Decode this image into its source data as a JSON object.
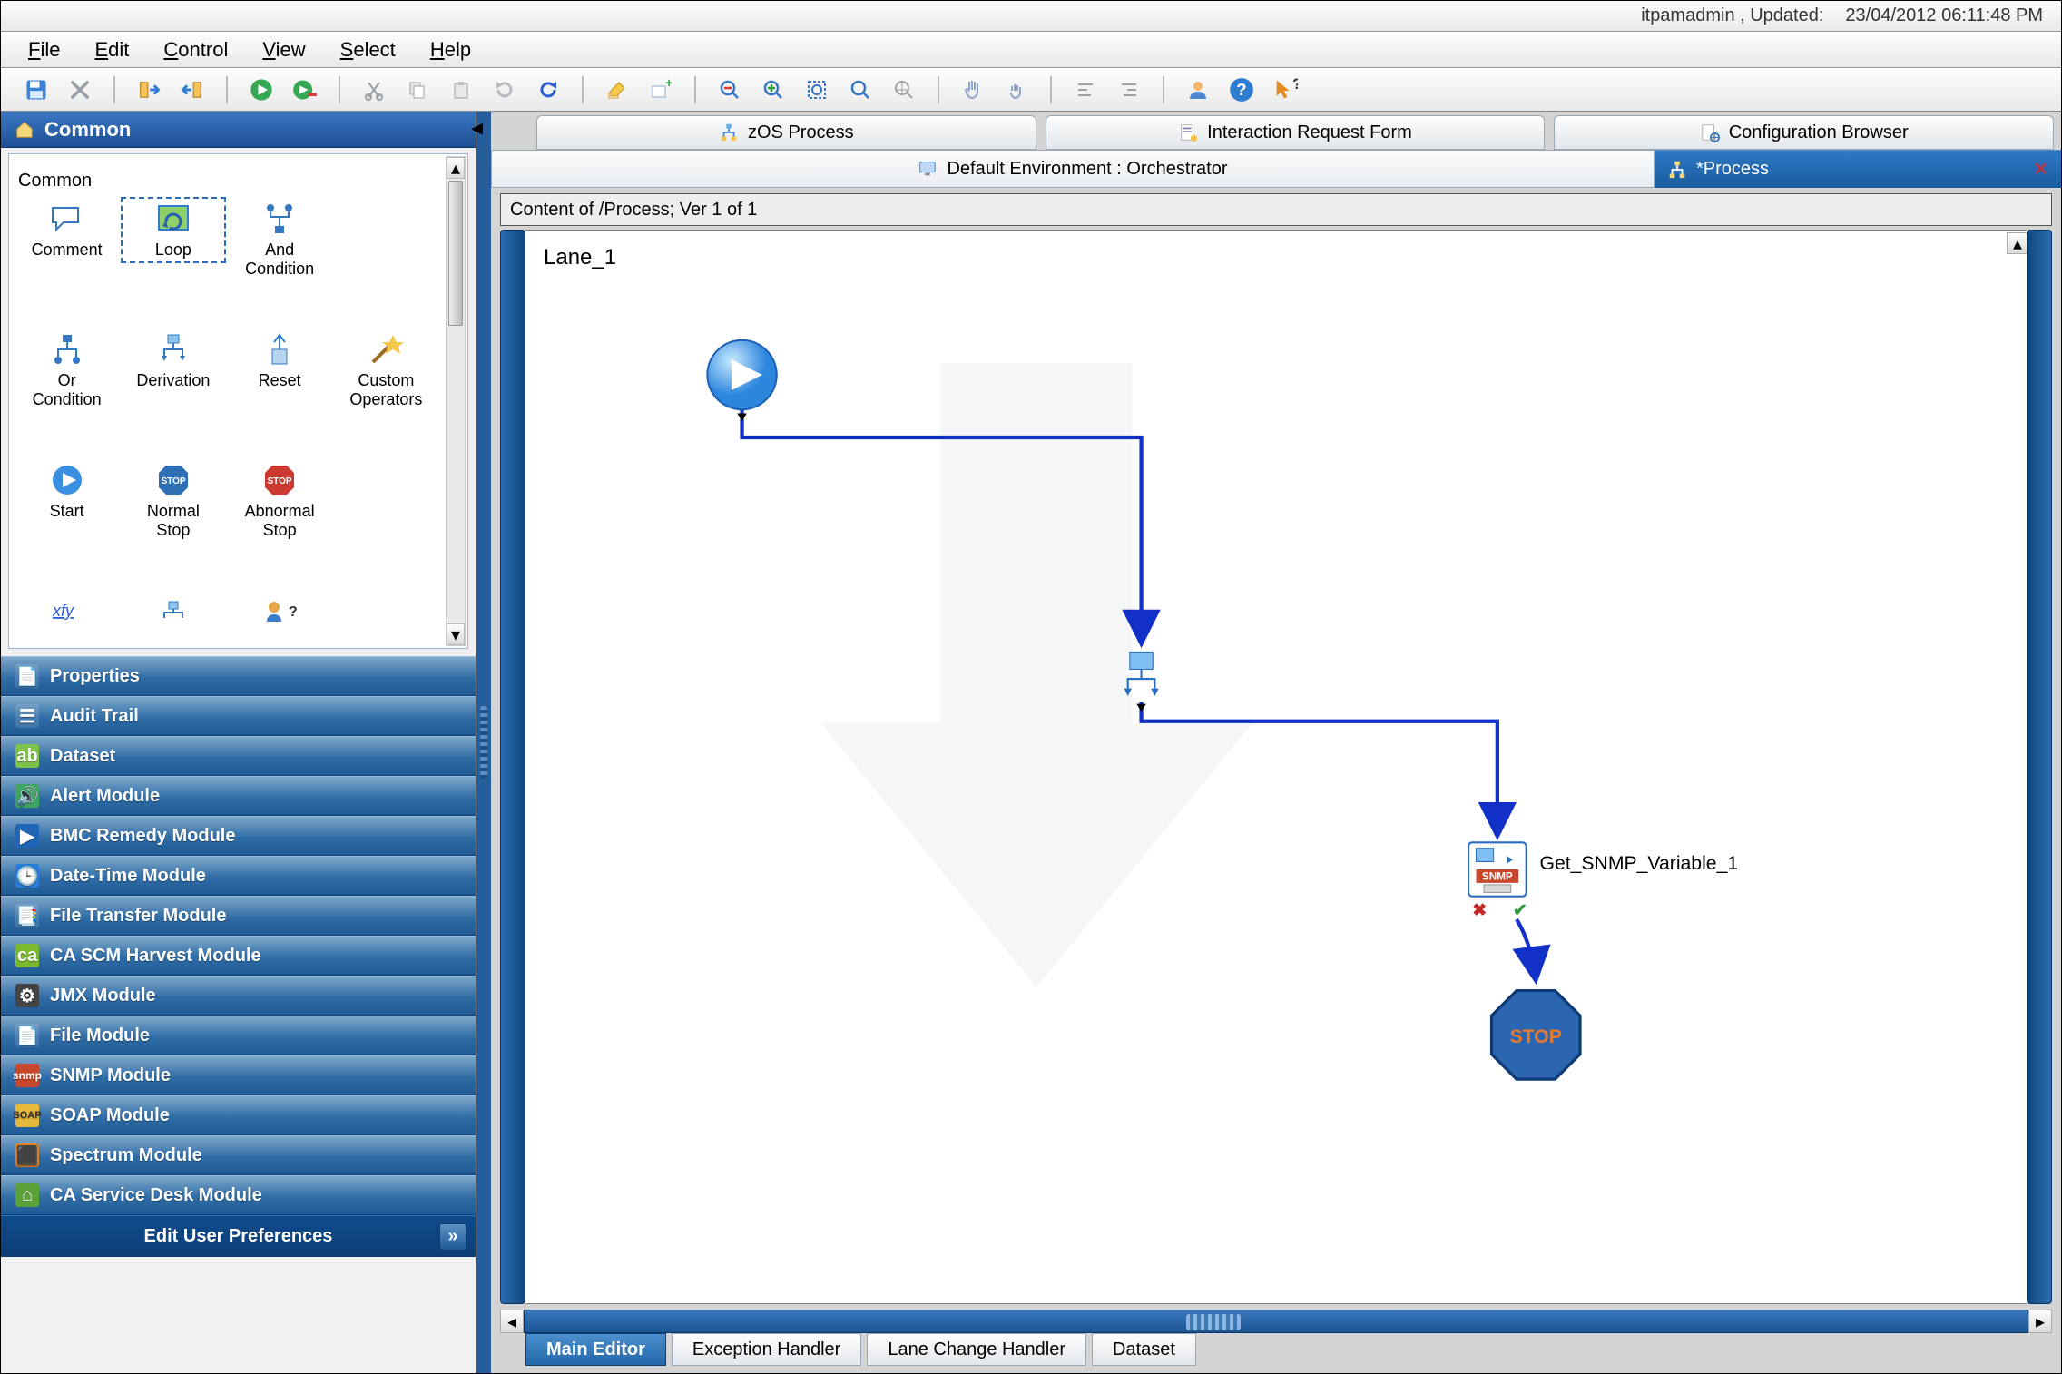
{
  "status": {
    "user_label": "itpamadmin , Updated:",
    "datetime": "23/04/2012 06:11:48 PM"
  },
  "menu": {
    "file": "File",
    "edit": "Edit",
    "control": "Control",
    "view": "View",
    "select": "Select",
    "help": "Help"
  },
  "left": {
    "header": "Common",
    "legend": "Common",
    "operators": [
      {
        "label": "Comment"
      },
      {
        "label": "Loop"
      },
      {
        "label": "And\nCondition"
      },
      {
        "label": ""
      },
      {
        "label": "Or\nCondition"
      },
      {
        "label": "Derivation"
      },
      {
        "label": "Reset"
      },
      {
        "label": "Custom\nOperators"
      },
      {
        "label": "Start"
      },
      {
        "label": "Normal\nStop"
      },
      {
        "label": "Abnormal\nStop"
      },
      {
        "label": ""
      }
    ],
    "accordion": [
      "Properties",
      "Audit Trail",
      "Dataset",
      "Alert Module",
      "BMC Remedy Module",
      "Date-Time Module",
      "File Transfer Module",
      "CA SCM Harvest Module",
      "JMX Module",
      "File Module",
      "SNMP Module",
      "SOAP Module",
      "Spectrum Module",
      "CA Service Desk Module"
    ],
    "prefs": "Edit User Preferences"
  },
  "top_tabs": [
    "zOS Process",
    "Interaction Request Form",
    "Configuration Browser"
  ],
  "env": {
    "left": "Default Environment : Orchestrator",
    "right": "*Process"
  },
  "content_title": "Content of /Process; Ver 1 of 1",
  "lane_label": "Lane_1",
  "node_label": "Get_SNMP_Variable_1",
  "stop_label": "STOP",
  "bottom_tabs": [
    "Main Editor",
    "Exception Handler",
    "Lane Change Handler",
    "Dataset"
  ]
}
